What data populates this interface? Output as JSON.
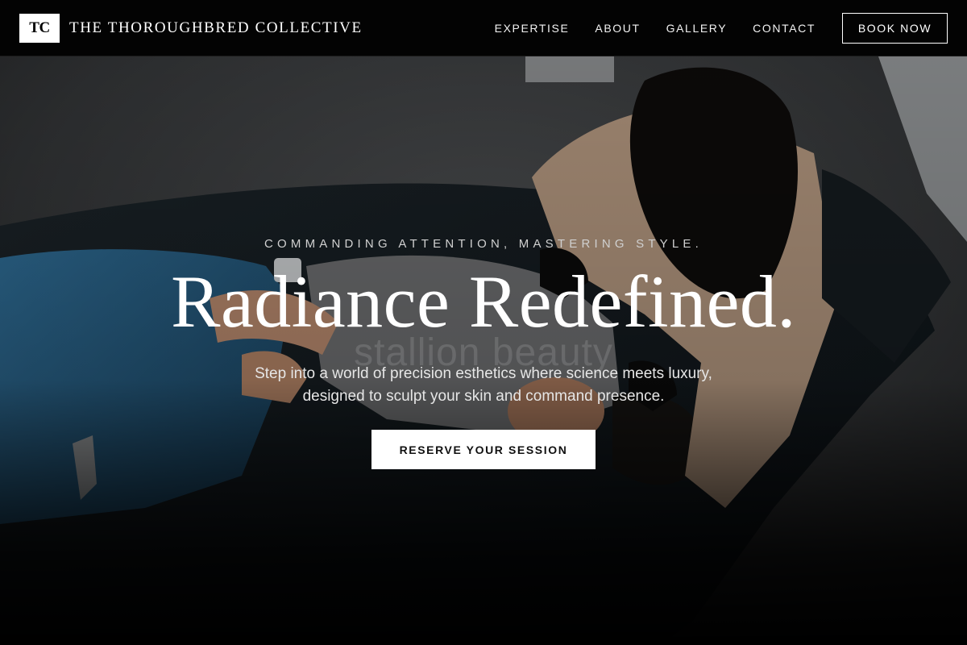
{
  "header": {
    "logo_mark": "TC",
    "brand_name": "THE THOROUGHBRED COLLECTIVE",
    "nav": [
      {
        "label": "EXPERTISE"
      },
      {
        "label": "ABOUT"
      },
      {
        "label": "GALLERY"
      },
      {
        "label": "CONTACT"
      }
    ],
    "book_label": "BOOK NOW"
  },
  "hero": {
    "tagline": "COMMANDING ATTENTION, MASTERING STYLE.",
    "headline": "Radiance Redefined.",
    "watermark": "stallion beauty",
    "subtext_line1": "Step into a world of precision esthetics where science meets luxury,",
    "subtext_line2": "designed to sculpt your skin and command presence.",
    "cta_label": "RESERVE YOUR SESSION"
  },
  "colors": {
    "nav_bg": "#030303",
    "cta_bg": "#ffffff",
    "cta_text": "#111111"
  }
}
